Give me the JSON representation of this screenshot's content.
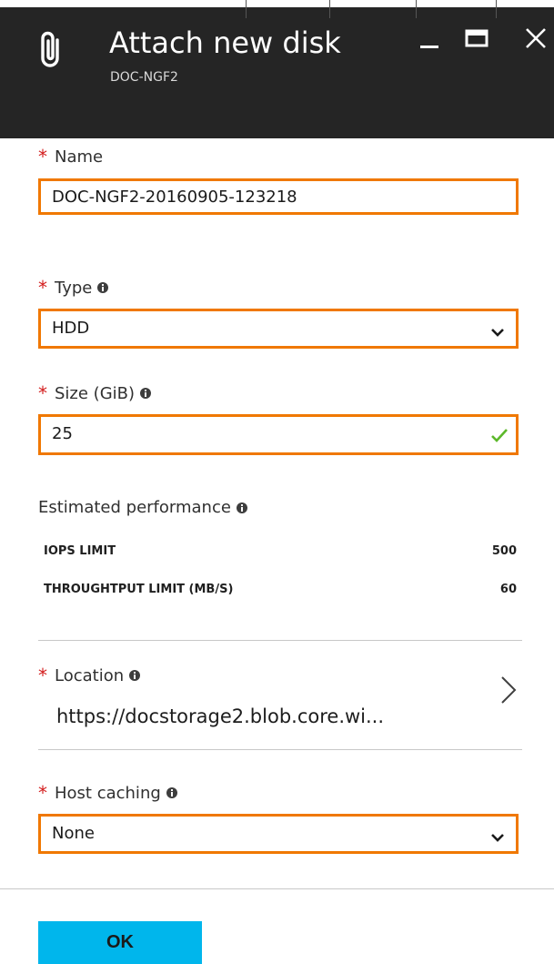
{
  "header": {
    "title": "Attach new disk",
    "subtitle": "DOC-NGF2",
    "icon": "paperclip-icon",
    "colors": {
      "background": "#252525",
      "text": "#ffffff"
    }
  },
  "window_controls": {
    "minimize": "minimize-icon",
    "maximize": "maximize-icon",
    "close": "close-icon"
  },
  "form": {
    "required_marker": "*",
    "name": {
      "label": "Name",
      "value": "DOC-NGF2-20160905-123218"
    },
    "type": {
      "label": "Type",
      "value": "HDD"
    },
    "size": {
      "label": "Size (GiB)",
      "value": "25"
    },
    "performance": {
      "label": "Estimated performance",
      "rows": [
        {
          "label": "IOPS LIMIT",
          "value": "500"
        },
        {
          "label": "THROUGHTPUT LIMIT (MB/S)",
          "value": "60"
        }
      ]
    },
    "location": {
      "label": "Location",
      "value": "https://docstorage2.blob.core.wi..."
    },
    "host_caching": {
      "label": "Host caching",
      "value": "None"
    }
  },
  "ok_button": {
    "label": "OK"
  },
  "colors": {
    "accent_border": "#f07800",
    "required": "#d31d1d",
    "valid": "#5cb82a",
    "ok_button": "#00b6ec"
  }
}
